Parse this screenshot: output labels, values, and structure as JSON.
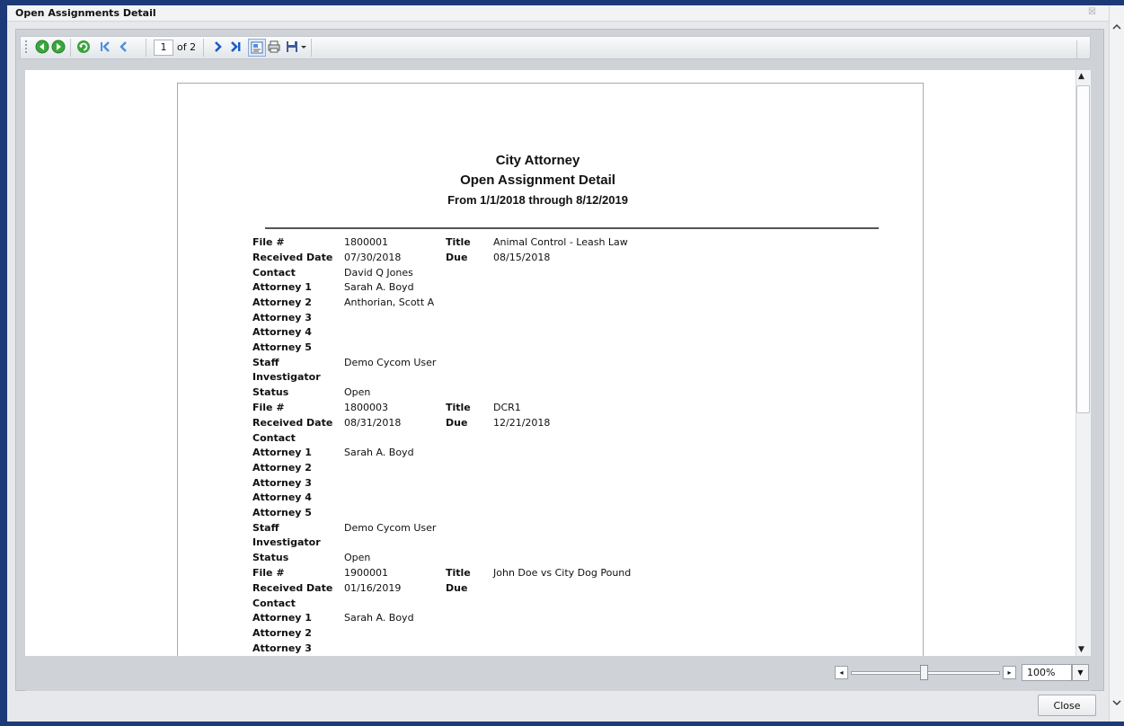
{
  "window": {
    "title": "Open Assignments Detail",
    "close_glyph": "☒"
  },
  "toolbar": {
    "page_value": "1",
    "page_of": "of 2",
    "icons": [
      "nav-back-icon",
      "nav-forward-icon",
      "refresh-icon",
      "first-page-icon",
      "prev-page-icon",
      "next-page-icon",
      "last-page-icon",
      "page-layout-icon",
      "print-icon",
      "save-icon"
    ]
  },
  "report": {
    "heading1": "City Attorney",
    "heading2": "Open Assignment Detail",
    "heading3": "From 1/1/2018 through 8/12/2019",
    "labels": {
      "file": "File #",
      "received": "Received Date",
      "contact": "Contact",
      "attorney1": "Attorney 1",
      "attorney2": "Attorney 2",
      "attorney3": "Attorney 3",
      "attorney4": "Attorney 4",
      "attorney5": "Attorney 5",
      "staff": "Staff",
      "investigator": "Investigator",
      "status": "Status",
      "title": "Title",
      "due": "Due"
    },
    "records": [
      {
        "file": "1800001",
        "received": "07/30/2018",
        "contact": "David Q Jones",
        "attorney1": "Sarah A. Boyd",
        "attorney2": "Anthorian, Scott A",
        "staff": "Demo Cycom User",
        "status": "Open",
        "title": "Animal Control - Leash Law",
        "due": "08/15/2018"
      },
      {
        "file": "1800003",
        "received": "08/31/2018",
        "contact": "",
        "attorney1": "Sarah A. Boyd",
        "attorney2": "",
        "staff": "Demo Cycom User",
        "status": "Open",
        "title": "DCR1",
        "due": "12/21/2018"
      },
      {
        "file": "1900001",
        "received": "01/16/2019",
        "contact": "",
        "attorney1": "Sarah A. Boyd",
        "attorney2": "",
        "title": "John Doe vs City Dog Pound",
        "due": ""
      }
    ]
  },
  "zoom": {
    "value": "100%",
    "level_percent": 100
  },
  "buttons": {
    "close": "Close"
  }
}
